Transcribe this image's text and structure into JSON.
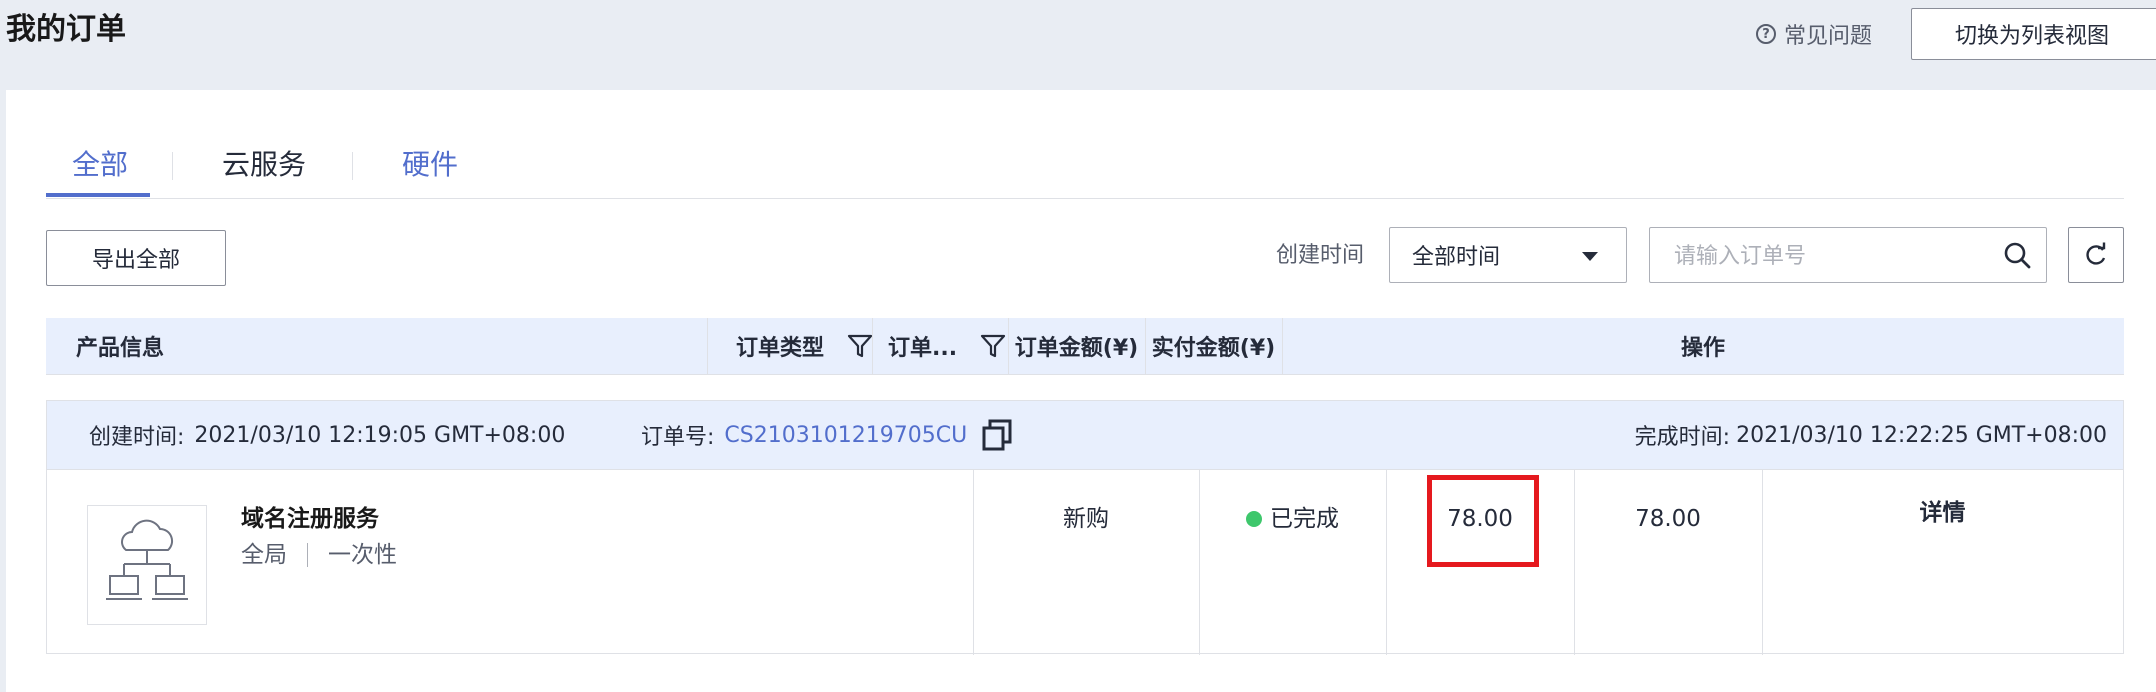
{
  "header": {
    "title": "我的订单",
    "faq_label": "常见问题",
    "switch_view_label": "切换为列表视图"
  },
  "tabs": [
    {
      "label": "全部",
      "active": true
    },
    {
      "label": "云服务",
      "active": false
    },
    {
      "label": "硬件",
      "active": false
    }
  ],
  "toolbar": {
    "export_label": "导出全部",
    "created_time_label": "创建时间",
    "time_filter_value": "全部时间",
    "search_placeholder": "请输入订单号"
  },
  "table": {
    "columns": [
      "产品信息",
      "订单类型",
      "订单...",
      "订单金额(¥)",
      "实付金额(¥)",
      "操作"
    ]
  },
  "order": {
    "created_label": "创建时间:",
    "created_value": "2021/03/10 12:19:05 GMT+08:00",
    "order_no_label": "订单号:",
    "order_no": "CS2103101219705CU",
    "completed_label": "完成时间:",
    "completed_value": "2021/03/10 12:22:25 GMT+08:00",
    "product_name": "域名注册服务",
    "product_region": "全局",
    "product_billing": "一次性",
    "type": "新购",
    "status": "已完成",
    "amount": "78.00",
    "paid": "78.00",
    "action": "详情"
  },
  "colors": {
    "accent": "#526ecc",
    "status_done": "#3ec76c",
    "highlight_box": "#e5191e",
    "header_bg": "#e8effd"
  }
}
